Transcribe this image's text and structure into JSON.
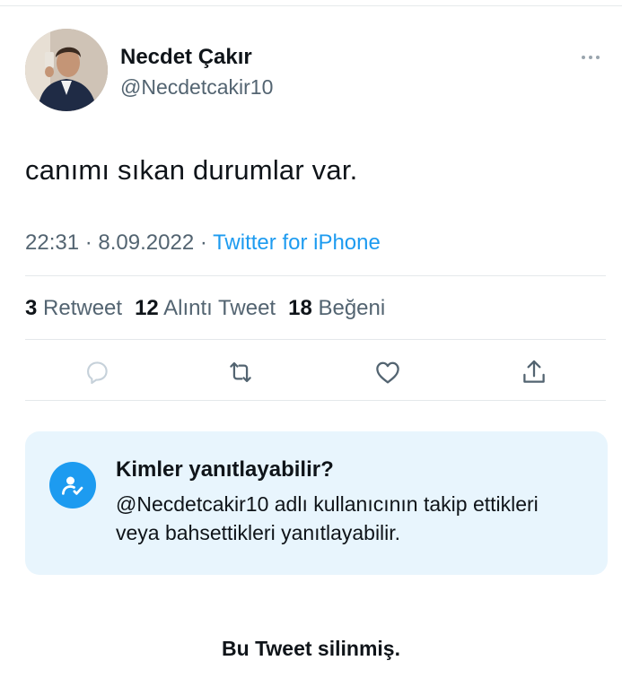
{
  "tweet": {
    "author_name": "Necdet Çakır",
    "author_handle": "@Necdetcakir10",
    "text": "canımı sıkan durumlar var.",
    "time": "22:31",
    "date": "8.09.2022",
    "source": "Twitter for iPhone"
  },
  "stats": {
    "retweets_count": "3",
    "retweets_label": "Retweet",
    "quotes_count": "12",
    "quotes_label": "Alıntı Tweet",
    "likes_count": "18",
    "likes_label": "Beğeni"
  },
  "actions": [
    "reply-icon",
    "retweet-icon",
    "like-icon",
    "share-icon"
  ],
  "reply_restriction": {
    "title": "Kimler yanıtlayabilir?",
    "description": "@Necdetcakir10 adlı kullanıcının takip ettikleri veya bahsettikleri yanıtlayabilir."
  },
  "footer": {
    "deleted_notice": "Bu Tweet silinmiş."
  },
  "colors": {
    "accent": "#1d9bf0",
    "secondary_text": "#536471",
    "card_background": "#e8f5fd"
  }
}
